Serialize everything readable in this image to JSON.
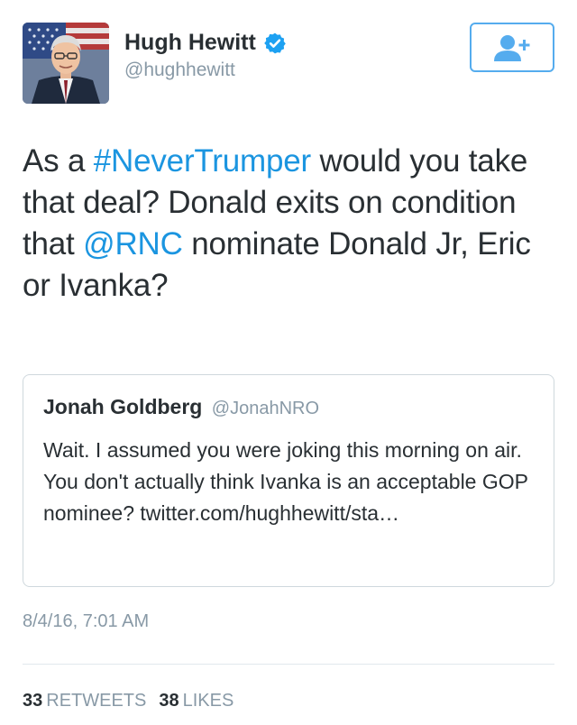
{
  "author": {
    "display_name": "Hugh Hewitt",
    "handle": "@hughhewitt",
    "verified": true,
    "avatar_icon": "profile-photo"
  },
  "follow_button": {
    "icon": "add-user-icon"
  },
  "tweet": {
    "segments": [
      {
        "text": "As a ",
        "link": false
      },
      {
        "text": "#NeverTrumper",
        "link": true
      },
      {
        "text": " would you take that deal? Donald exits on condition that ",
        "link": false
      },
      {
        "text": "@RNC",
        "link": true
      },
      {
        "text": " nominate Donald Jr, Eric or Ivanka?",
        "link": false
      }
    ]
  },
  "quoted_tweet": {
    "display_name": "Jonah Goldberg",
    "handle": "@JonahNRO",
    "text": "Wait. I assumed you were joking this morning on air. You don't actually think Ivanka is an acceptable GOP nominee? twitter.com/hughhewitt/sta…"
  },
  "timestamp": "8/4/16, 7:01 AM",
  "stats": {
    "retweets_count": "33",
    "retweets_label": "RETWEETS",
    "likes_count": "38",
    "likes_label": "LIKES"
  },
  "colors": {
    "link": "#1b95e0",
    "accent": "#55acee",
    "muted": "#8899a6",
    "text": "#292f33"
  }
}
